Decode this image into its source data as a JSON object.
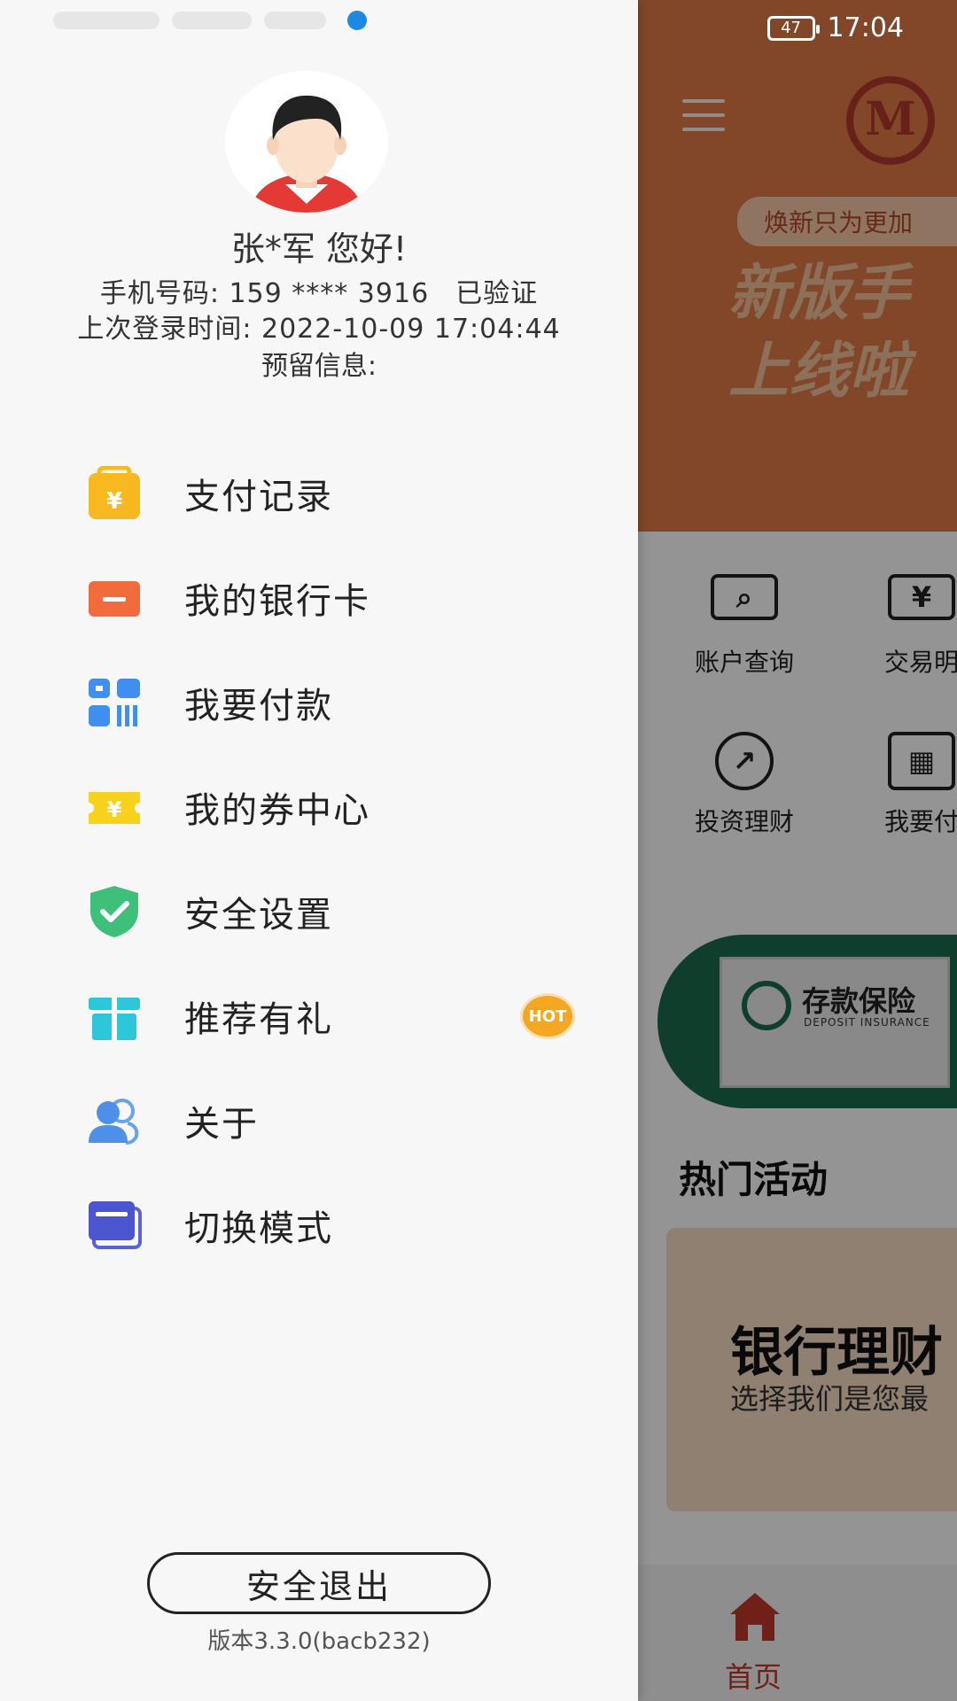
{
  "status_bar": {
    "battery": "47",
    "time": "17:04"
  },
  "drawer": {
    "greeting": "张*军 您好!",
    "phone_label": "手机号码: 159 **** 3916",
    "phone_verified": "已验证",
    "last_login": "上次登录时间: 2022-10-09 17:04:44",
    "reserved_info": "预留信息:",
    "menu": [
      {
        "label": "支付记录",
        "icon": "payment-record-icon"
      },
      {
        "label": "我的银行卡",
        "icon": "bank-card-icon"
      },
      {
        "label": "我要付款",
        "icon": "pay-code-icon"
      },
      {
        "label": "我的券中心",
        "icon": "coupon-icon"
      },
      {
        "label": "安全设置",
        "icon": "shield-check-icon"
      },
      {
        "label": "推荐有礼",
        "icon": "gift-icon",
        "badge": "HOT"
      },
      {
        "label": "关于",
        "icon": "users-icon"
      },
      {
        "label": "切换模式",
        "icon": "switch-mode-icon"
      }
    ],
    "logout_label": "安全退出",
    "version": "版本3.3.0(bacb232)"
  },
  "background": {
    "promo_tag": "焕新只为更加",
    "promo_line1": "新版手",
    "promo_line2": "上线啦",
    "grid": [
      {
        "label": "账户查询",
        "icon": "account-query-icon"
      },
      {
        "label": "交易明",
        "icon": "transaction-icon"
      },
      {
        "label": "投资理财",
        "icon": "investment-icon"
      },
      {
        "label": "我要付",
        "icon": "qr-pay-icon"
      }
    ],
    "deposit_title": "存款保险",
    "deposit_sub": "DEPOSIT INSURANCE",
    "hot_title": "热门活动",
    "card_title": "银行理财",
    "card_sub": "选择我们是您最",
    "nav_home": "首页"
  },
  "colors": {
    "accent_red": "#c0392b",
    "hero_orange": "#e07a45",
    "deposit_green": "#1a6b4d",
    "hot_badge": "#f5a623"
  }
}
